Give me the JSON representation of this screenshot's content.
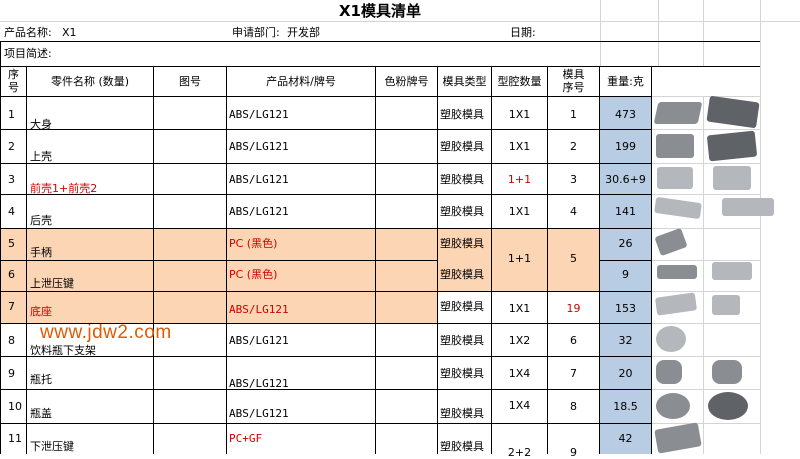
{
  "title": "X1模具清单",
  "info": {
    "product_label": "产品名称:",
    "product_value": "X1",
    "dept_label": "申请部门:",
    "dept_value": "开发部",
    "date_label": "日期:",
    "summary_label": "项目简述:"
  },
  "headers": {
    "seq_line1": "序",
    "seq_line2": "号",
    "part": "零件名称 (数量)",
    "drawing": "图号",
    "material": "产品材料/牌号",
    "color": "色粉牌号",
    "mold_type": "模具类型",
    "cavity": "型腔数量",
    "mold_seq_line1": "模具",
    "mold_seq_line2": "序号",
    "weight": "重量:克"
  },
  "rows": [
    {
      "no": "1",
      "part": "大身",
      "material": "ABS/LG121",
      "type": "塑胶模具",
      "cavity": "1X1",
      "mold": "1",
      "weight": "473"
    },
    {
      "no": "2",
      "part": "上壳",
      "material": "ABS/LG121",
      "type": "塑胶模具",
      "cavity": "1X1",
      "mold": "2",
      "weight": "199"
    },
    {
      "no": "3",
      "part": "前壳1+前壳2",
      "material": "ABS/LG121",
      "type": "塑胶模具",
      "cavity": "1+1",
      "mold": "3",
      "weight": "30.6+9"
    },
    {
      "no": "4",
      "part": "后壳",
      "material": "ABS/LG121",
      "type": "塑胶模具",
      "cavity": "1X1",
      "mold": "4",
      "weight": "141"
    },
    {
      "no": "5",
      "part": "手柄",
      "material": "PC (黑色)",
      "type": "塑胶模具",
      "cavity": "",
      "mold": "",
      "weight": "26"
    },
    {
      "no": "6",
      "part": "上泄压键",
      "material": "PC (黑色)",
      "type": "塑胶模具",
      "cavity": "",
      "mold": "",
      "weight": "9"
    },
    {
      "no": "7",
      "part": "底座",
      "material": "ABS/LG121",
      "type": "塑胶模具",
      "cavity": "1X1",
      "mold": "19",
      "weight": "153"
    },
    {
      "no": "8",
      "part": "饮料瓶下支架",
      "material": "ABS/LG121",
      "type": "塑胶模具",
      "cavity": "1X2",
      "mold": "6",
      "weight": "32"
    },
    {
      "no": "9",
      "part": "瓶托",
      "material": "ABS/LG121",
      "type": "塑胶模具",
      "cavity": "1X4",
      "mold": "7",
      "weight": "20"
    },
    {
      "no": "10",
      "part": "瓶盖",
      "material": "ABS/LG121",
      "type": "塑胶模具",
      "cavity": "1X4",
      "mold": "8",
      "weight": "18.5"
    },
    {
      "no": "11",
      "part": "下泄压键",
      "material": "PC+GF",
      "type": "塑胶模具",
      "cavity": "2+2",
      "mold": "9",
      "weight": "42"
    }
  ],
  "merged_5_6": {
    "cavity": "1+1",
    "mold": "5"
  },
  "watermark": "www.jdw2.com",
  "colors": {
    "orange_fill": "#fcd5b4",
    "blue_fill": "#b8cce4",
    "red_text": "#d00000",
    "watermark": "#e05a00"
  }
}
